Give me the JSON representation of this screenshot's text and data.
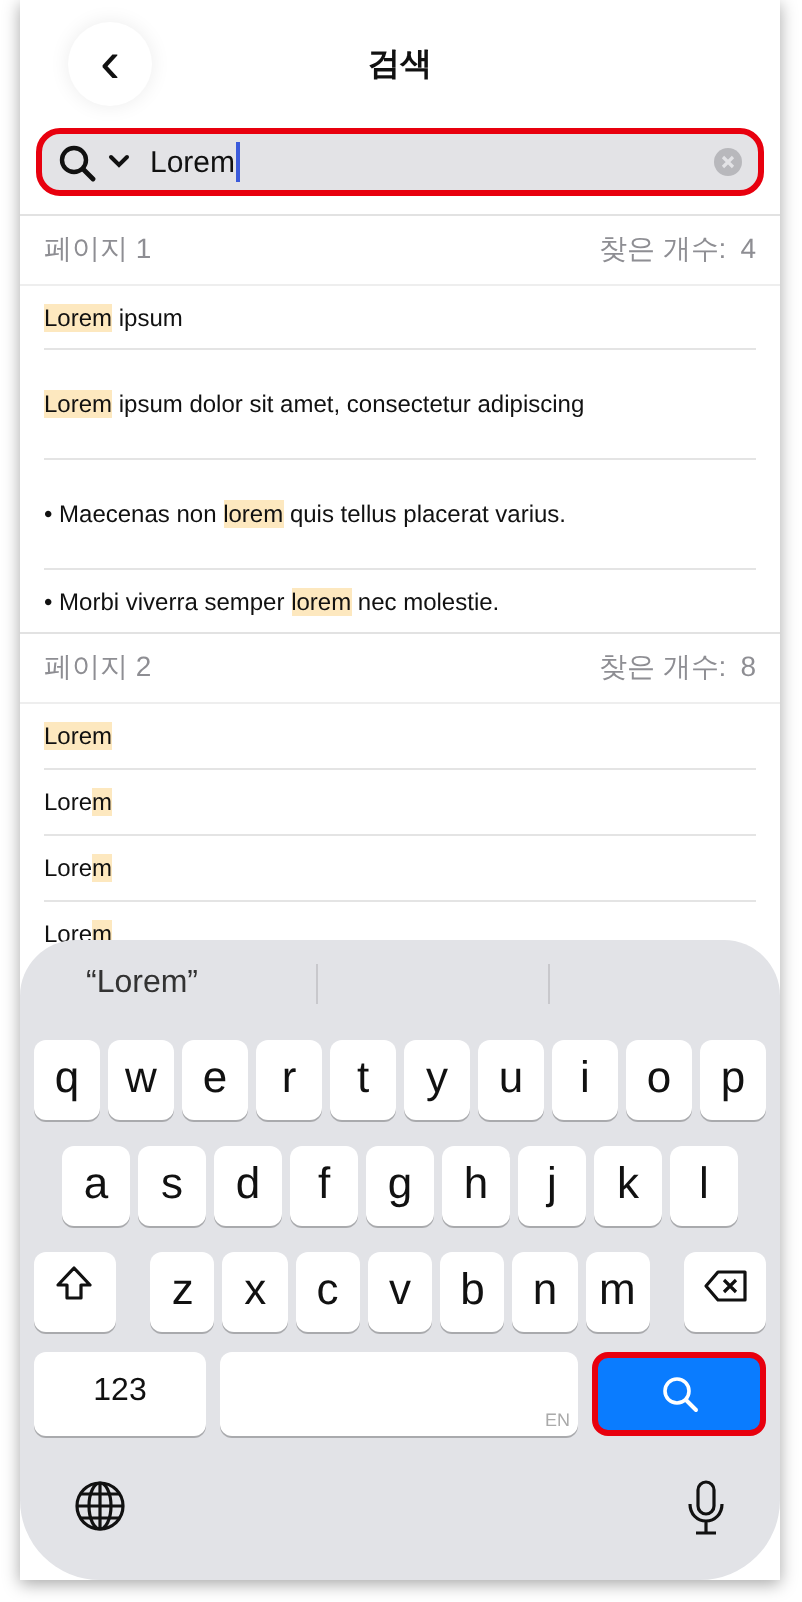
{
  "header": {
    "back": "‹",
    "title": "검색"
  },
  "search": {
    "value": "Lorem",
    "focused": true,
    "outlined": true
  },
  "sections": [
    {
      "page": "페이지 1",
      "count_label": "찾은 개수:",
      "count": "4",
      "rows": [
        {
          "segments": [
            {
              "text": "Lorem",
              "highlighted": true
            },
            {
              "text": " ipsum",
              "highlighted": false
            }
          ]
        },
        {
          "segments": [
            {
              "text": "Lorem",
              "highlighted": true
            },
            {
              "text": " ipsum dolor sit amet, consectetur adipiscing",
              "highlighted": false
            }
          ]
        },
        {
          "segments": [
            {
              "text": "• Maecenas non ",
              "highlighted": false
            },
            {
              "text": "lorem",
              "highlighted": true
            },
            {
              "text": " quis tellus placerat varius.",
              "highlighted": false
            }
          ]
        },
        {
          "segments": [
            {
              "text": "• Morbi viverra semper ",
              "highlighted": false
            },
            {
              "text": "lorem",
              "highlighted": true
            },
            {
              "text": " nec molestie.",
              "highlighted": false
            }
          ]
        }
      ]
    },
    {
      "page": "페이지 2",
      "count_label": "찾은 개수:",
      "count": "8",
      "rows": [
        {
          "segments": [
            {
              "text": "Lorem",
              "highlighted": true
            }
          ]
        },
        {
          "segments": [
            {
              "text": "Lore",
              "highlighted": false
            },
            {
              "text": "m",
              "highlighted": true
            }
          ]
        },
        {
          "segments": [
            {
              "text": "Lore",
              "highlighted": false
            },
            {
              "text": "m",
              "highlighted": true
            }
          ]
        },
        {
          "segments": [
            {
              "text": "Lore",
              "highlighted": false
            },
            {
              "text": "m",
              "highlighted": true
            }
          ]
        }
      ]
    }
  ],
  "keyboard": {
    "suggestions": [
      "“Lorem”"
    ],
    "rows": [
      [
        "q",
        "w",
        "e",
        "r",
        "t",
        "y",
        "u",
        "i",
        "o",
        "p"
      ],
      [
        "a",
        "s",
        "d",
        "f",
        "g",
        "h",
        "j",
        "k",
        "l"
      ],
      [
        "z",
        "x",
        "c",
        "v",
        "b",
        "n",
        "m"
      ]
    ],
    "numbers_key": "123",
    "space_hint": "EN",
    "search_key": {
      "outlined": true
    }
  }
}
